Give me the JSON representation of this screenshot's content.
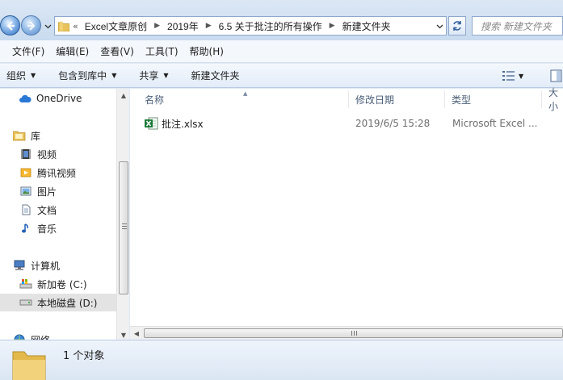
{
  "address": {
    "overflow_glyph": "«",
    "breadcrumbs": [
      "Excel文章原创",
      "2019年",
      "6.5 关于批注的所有操作",
      "新建文件夹"
    ]
  },
  "search": {
    "placeholder": "搜索 新建文件夹"
  },
  "menu": [
    "文件(F)",
    "编辑(E)",
    "查看(V)",
    "工具(T)",
    "帮助(H)"
  ],
  "toolbar": {
    "organize": "组织",
    "include_in_library": "包含到库中",
    "share": "共享",
    "new_folder": "新建文件夹"
  },
  "nav": {
    "onedrive": "OneDrive",
    "library": "库",
    "videos": "视频",
    "tencent_video": "腾讯视频",
    "pictures": "图片",
    "documents": "文档",
    "music": "音乐",
    "computer": "计算机",
    "drive_c": "新加卷 (C:)",
    "drive_d": "本地磁盘 (D:)",
    "network": "网络"
  },
  "columns": {
    "name": "名称",
    "modified": "修改日期",
    "type": "类型",
    "size": "大小"
  },
  "files": [
    {
      "name": "批注.xlsx",
      "modified": "2019/6/5 15:28",
      "type": "Microsoft Excel ..."
    }
  ],
  "status": {
    "count": "1 个对象"
  },
  "colors": {
    "excel_green": "#1d7a3a",
    "folder_yellow": "#e8c25a",
    "selection_gray": "#e3e3e3"
  }
}
